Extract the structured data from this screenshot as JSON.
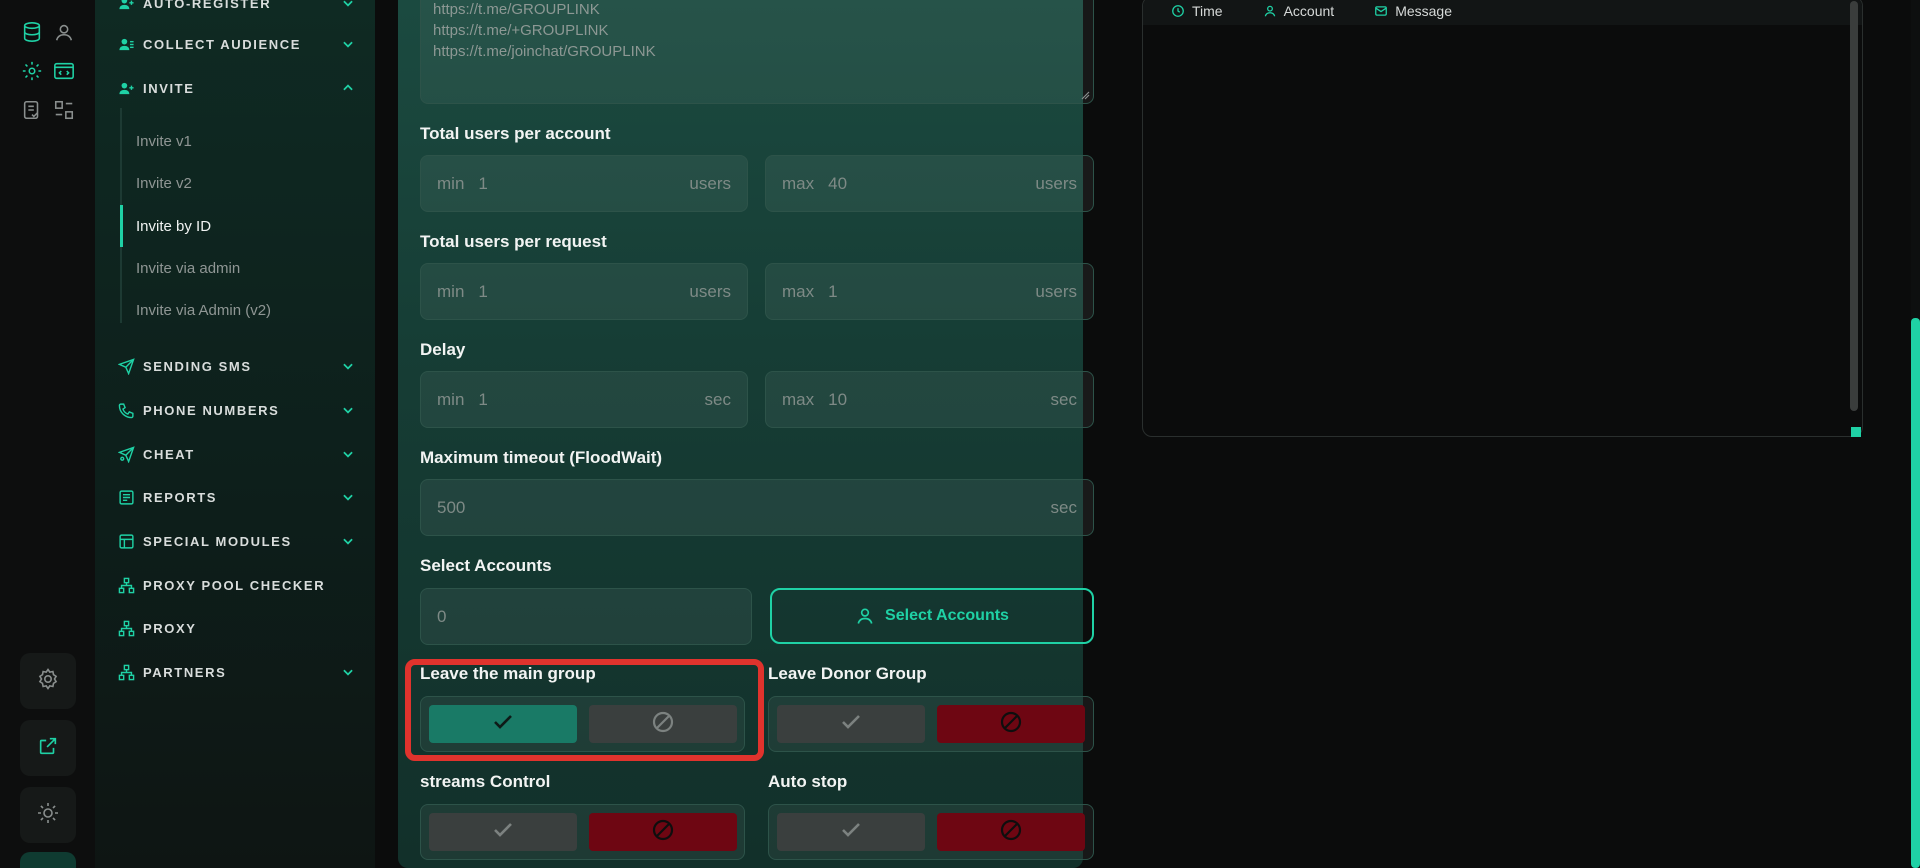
{
  "sidebar": {
    "items": [
      {
        "label": "AUTO-REGISTER",
        "icon": "user-plus-icon",
        "chevron": "down"
      },
      {
        "label": "COLLECT AUDIENCE",
        "icon": "users-icon",
        "chevron": "down"
      },
      {
        "label": "INVITE",
        "icon": "user-add-icon",
        "chevron": "up"
      },
      {
        "label": "SENDING SMS",
        "icon": "send-icon",
        "chevron": "down"
      },
      {
        "label": "PHONE NUMBERS",
        "icon": "phone-icon",
        "chevron": "down"
      },
      {
        "label": "CHEAT",
        "icon": "megaphone-icon",
        "chevron": "down"
      },
      {
        "label": "REPORTS",
        "icon": "report-icon",
        "chevron": "down"
      },
      {
        "label": "SPECIAL MODULES",
        "icon": "modules-icon",
        "chevron": "down"
      },
      {
        "label": "PROXY POOL CHECKER",
        "icon": "network-icon",
        "chevron": ""
      },
      {
        "label": "PROXY",
        "icon": "network-icon",
        "chevron": ""
      },
      {
        "label": "PARTNERS",
        "icon": "network-icon",
        "chevron": "down"
      }
    ],
    "invite_sub": [
      "Invite v1",
      "Invite v2",
      "Invite by ID",
      "Invite via admin",
      "Invite via Admin (v2)"
    ],
    "active_sub": "Invite by ID"
  },
  "form": {
    "links": [
      "https://t.me/GROUPLINK",
      "https://t.me/+GROUPLINK",
      "https://t.me/joinchat/GROUPLINK"
    ],
    "users_per_account": {
      "label": "Total users per account",
      "min_prefix": "min",
      "min": "1",
      "max_prefix": "max",
      "max": "40",
      "unit": "users"
    },
    "users_per_request": {
      "label": "Total users per request",
      "min_prefix": "min",
      "min": "1",
      "max_prefix": "max",
      "max": "1",
      "unit": "users"
    },
    "delay": {
      "label": "Delay",
      "min_prefix": "min",
      "min": "1",
      "max_prefix": "max",
      "max": "10",
      "unit": "sec"
    },
    "timeout": {
      "label": "Maximum timeout (FloodWait)",
      "value": "500",
      "unit": "sec"
    },
    "select_accounts": {
      "label": "Select Accounts",
      "value": "0",
      "button": "Select Accounts"
    },
    "leave_main": {
      "label": "Leave the main group",
      "state": "on"
    },
    "leave_donor": {
      "label": "Leave Donor Group",
      "state": "off"
    },
    "streams": {
      "label": "streams Control",
      "state": "off"
    },
    "auto_stop": {
      "label": "Auto stop",
      "state": "off"
    }
  },
  "log": {
    "columns": [
      "Time",
      "Account",
      "Message"
    ]
  },
  "colors": {
    "accent": "#1fd1a5",
    "danger": "#6e0612",
    "highlight": "#e0332d"
  }
}
